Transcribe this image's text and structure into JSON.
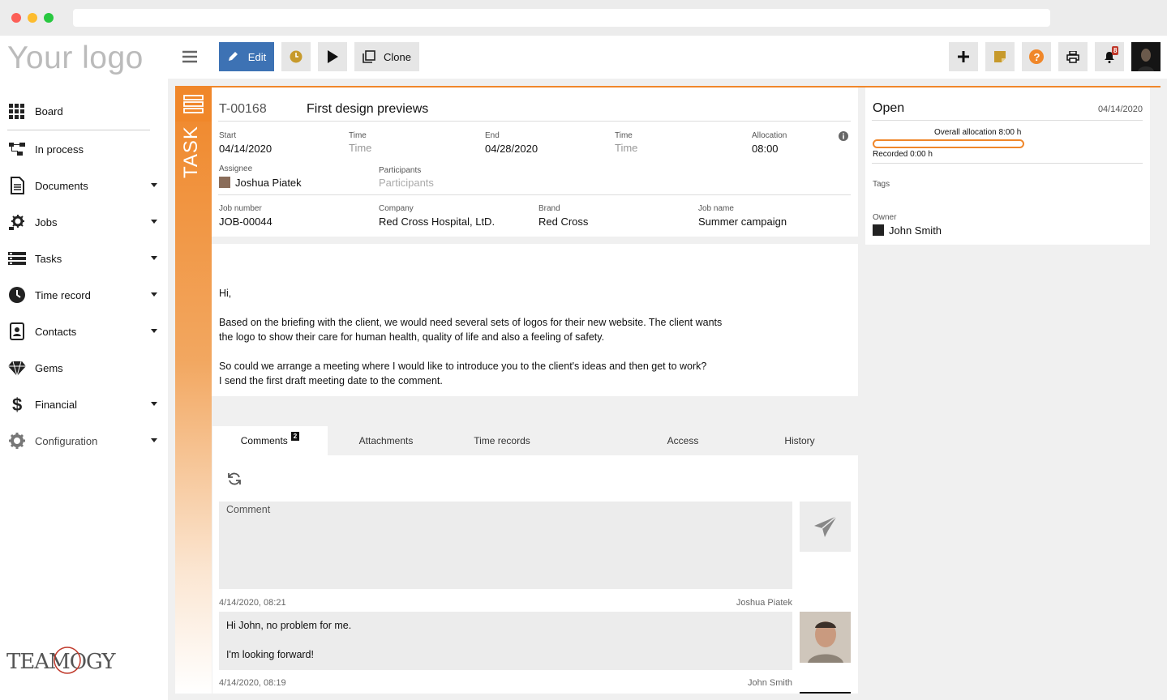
{
  "app": {
    "logo_text": "Your logo",
    "brand_name": "TEAMOGY"
  },
  "sidebar": {
    "items": [
      {
        "label": "Board",
        "icon": "grid-icon",
        "has_caret": false
      },
      {
        "label": "In process",
        "icon": "flow-icon",
        "has_caret": false
      },
      {
        "label": "Documents",
        "icon": "document-icon",
        "has_caret": true
      },
      {
        "label": "Jobs",
        "icon": "jobs-gear-icon",
        "has_caret": true
      },
      {
        "label": "Tasks",
        "icon": "tasks-icon",
        "has_caret": true
      },
      {
        "label": "Time record",
        "icon": "clock-icon",
        "has_caret": true
      },
      {
        "label": "Contacts",
        "icon": "contacts-icon",
        "has_caret": true
      },
      {
        "label": "Gems",
        "icon": "gem-icon",
        "has_caret": false
      },
      {
        "label": "Financial",
        "icon": "dollar-icon",
        "has_caret": true
      },
      {
        "label": "Configuration",
        "icon": "gear-icon",
        "has_caret": true
      }
    ]
  },
  "toolbar": {
    "edit_label": "Edit",
    "clone_label": "Clone",
    "notification_count": "8",
    "accent_color": "#3d72b4"
  },
  "task": {
    "strip_label": "TASK",
    "id": "T-00168",
    "title": "First design previews",
    "start_label": "Start",
    "start_value": "04/14/2020",
    "time_label": "Time",
    "time_placeholder": "Time",
    "end_label": "End",
    "end_value": "04/28/2020",
    "end_time_label": "Time",
    "end_time_placeholder": "Time",
    "allocation_label": "Allocation",
    "allocation_value": "08:00",
    "assignee_label": "Assignee",
    "assignee_value": "Joshua Piatek",
    "participants_label": "Participants",
    "participants_placeholder": "Participants",
    "job_number_label": "Job number",
    "job_number_value": "JOB-00044",
    "company_label": "Company",
    "company_value": "Red Cross Hospital, LtD.",
    "brand_label": "Brand",
    "brand_value": "Red Cross",
    "job_name_label": "Job name",
    "job_name_value": "Summer campaign"
  },
  "description": {
    "lines": [
      "Hi,",
      "Based on the briefing with the client, we would need several sets of logos for their new website. The client wants",
      "the logo to show their care for human health, quality of life and also a feeling of safety.",
      "So could we arrange a meeting where I would like to introduce you to the client's ideas and then get to work?",
      "I send the first draft meeting date to the comment."
    ]
  },
  "tabs": [
    {
      "label": "Comments",
      "badge": "2",
      "active": true
    },
    {
      "label": "Attachments"
    },
    {
      "label": "Time records"
    },
    {
      "label": "Access"
    },
    {
      "label": "History"
    }
  ],
  "comments": {
    "placeholder": "Comment",
    "items": [
      {
        "timestamp": "4/14/2020, 08:21",
        "author": "Joshua Piatek",
        "lines": [
          "Hi John, no problem for me.",
          "I'm looking forward!"
        ]
      },
      {
        "timestamp": "4/14/2020, 08:19",
        "author": "John Smith"
      }
    ]
  },
  "status_panel": {
    "status": "Open",
    "date": "04/14/2020",
    "overall_allocation": "Overall allocation 8:00 h",
    "recorded": "Recorded 0:00 h",
    "recorded_fraction": 0.0,
    "tags_label": "Tags",
    "owner_label": "Owner",
    "owner_value": "John Smith"
  }
}
